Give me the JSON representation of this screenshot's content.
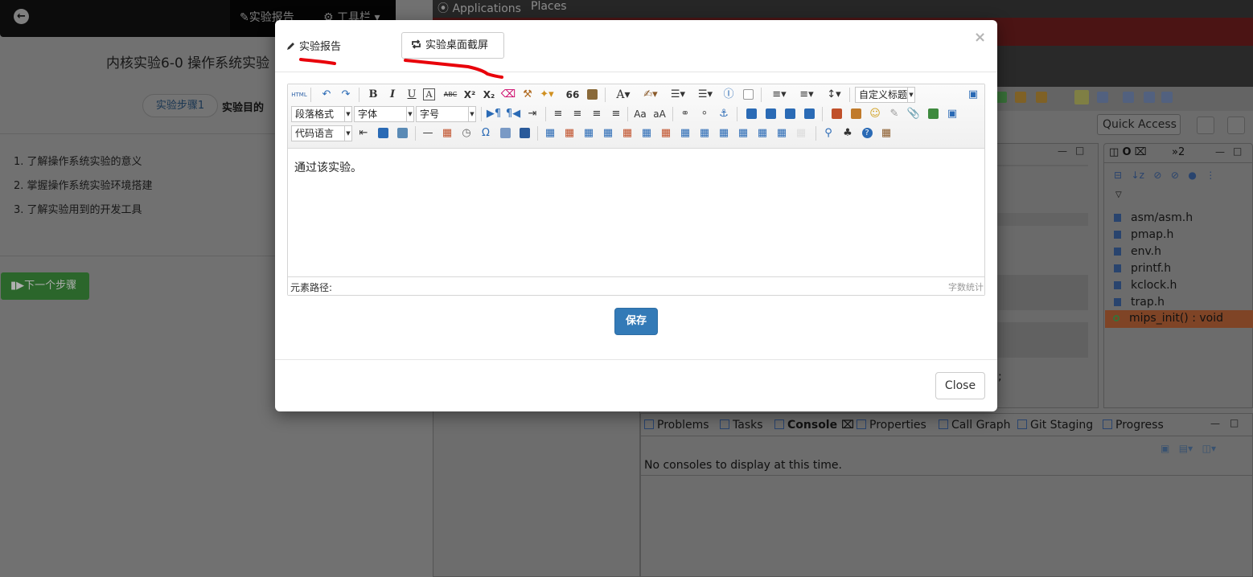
{
  "left_panel": {
    "topbar": {
      "report_label": "实验报告",
      "toolbar_label": "工具栏"
    },
    "title": "内核实验6-0 操作系统实验",
    "step_pill": "实验步骤1",
    "step_goal": "实验目的",
    "objectives": [
      "1. 了解操作系统实验的意义",
      "2. 掌握操作系统实验环境搭建",
      "3. 了解实验用到的开发工具"
    ],
    "next_button": "下一个步骤"
  },
  "ide": {
    "menu": {
      "applications": "Applications",
      "places": "Places"
    },
    "quick_access": "Quick Access",
    "outline": {
      "tab_label": "O",
      "tab2_label": "»2",
      "items": [
        "asm/asm.h",
        "pmap.h",
        "env.h",
        "printf.h",
        "kclock.h",
        "trap.h"
      ],
      "selected_item": "mips_init() : void"
    },
    "editor_fragment": ";",
    "console": {
      "tabs": [
        "Problems",
        "Tasks",
        "Console",
        "Properties",
        "Call Graph",
        "Git Staging",
        "Progress"
      ],
      "message": "No consoles to display at this time."
    }
  },
  "modal": {
    "tab_report": "实验报告",
    "tab_screenshot": "实验桌面截屏",
    "close_x": "×",
    "toolbar": {
      "html_btn": "HTML",
      "bold": "B",
      "italic": "I",
      "underline": "U",
      "font_border": "A",
      "strike": "ABC",
      "superscript": "X²",
      "subscript": "X₂",
      "quote": "66",
      "font_color": "A",
      "custom_title": "自定义标题",
      "paragraph_format": "段落格式",
      "font_family": "字体",
      "font_size": "字号",
      "code_language": "代码语言",
      "omega": "Ω"
    },
    "body_text": "通过该实验。",
    "element_path": "元素路径:",
    "word_count": "字数统计",
    "save_label": "保存",
    "close_label": "Close"
  },
  "colors": {
    "primary": "#337ab7",
    "success": "#3c8f3c",
    "annotation": "#e8000a"
  }
}
